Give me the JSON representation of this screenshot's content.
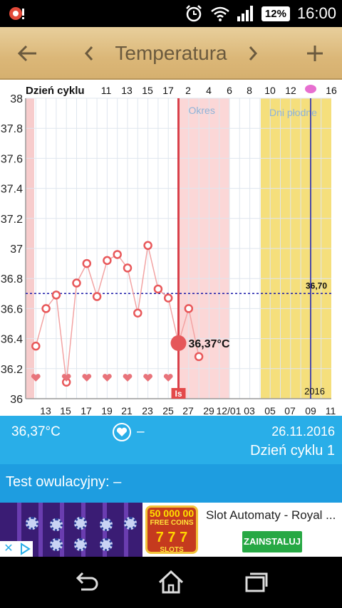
{
  "status_bar": {
    "battery": "12%",
    "time": "16:00",
    "icons": [
      "app-notification-icon",
      "alarm-clock-icon",
      "wifi-icon",
      "signal-icon",
      "battery-icon"
    ]
  },
  "toolbar": {
    "title": "Temperatura",
    "back_icon": "arrow-left-icon",
    "prev_icon": "chevron-left-icon",
    "next_icon": "chevron-right-icon",
    "add_icon": "plus-icon"
  },
  "chart_data": {
    "type": "line",
    "top_axis_title": "Dzień cyklu",
    "top_tick_labels": [
      "11",
      "13",
      "15",
      "17",
      "2",
      "4",
      "6",
      "8",
      "10",
      "12",
      "16"
    ],
    "bottom_tick_labels": [
      "13",
      "15",
      "17",
      "19",
      "21",
      "23",
      "25",
      "27",
      "29",
      "12/01",
      "03",
      "05",
      "07",
      "09",
      "11"
    ],
    "y_tick_labels": [
      "38",
      "37.8",
      "37.6",
      "37.4",
      "37.2",
      "37",
      "36.8",
      "36.6",
      "36.4",
      "36.2",
      "36"
    ],
    "ylim": [
      36,
      38
    ],
    "x": [
      "12",
      "13",
      "14",
      "15",
      "16",
      "17",
      "18",
      "19",
      "20",
      "21",
      "22",
      "23",
      "24",
      "25",
      "26",
      "27",
      "28"
    ],
    "values": [
      36.35,
      36.6,
      36.69,
      36.11,
      36.77,
      36.9,
      36.68,
      36.92,
      36.96,
      36.87,
      36.57,
      37.02,
      36.73,
      36.67,
      36.37,
      36.6,
      36.28
    ],
    "heart_days": [
      "12",
      "15",
      "17",
      "19",
      "21",
      "23",
      "25"
    ],
    "reference_line": {
      "value": 36.7,
      "label": "36,70"
    },
    "selected_point": {
      "x": "26",
      "value": 36.37,
      "label": "36,37°C"
    },
    "bands": [
      {
        "label": "",
        "color": "#f7cccc"
      },
      {
        "label": "Okres",
        "color": "#fbd7d7"
      },
      {
        "label": "Dni płodne",
        "color": "#f5df7c"
      }
    ],
    "period_marker_label": "Is",
    "year_label": "2016",
    "grid": true,
    "colors": {
      "line": "#f2a3a3",
      "marker": "#e8585a",
      "today_line": "#d9404a",
      "ref_line": "#1a1aa8",
      "ovulation_line": "#1a1aa8"
    }
  },
  "info": {
    "temperature": "36,37°C",
    "heart_text": "–",
    "date": "26.11.2016",
    "cycle_day": "Dzień cyklu 1"
  },
  "ovulation_test": {
    "label": "Test owulacyjny: –"
  },
  "ad": {
    "logo_big": "50 000 00",
    "logo_small": "FREE COINS",
    "logo_slots": "SLOTS",
    "title": "Slot Automaty - Royal ...",
    "install_label": "ZAINSTALUJ"
  },
  "nav": {
    "back_icon": "back-icon",
    "home_icon": "home-icon",
    "recents_icon": "recents-icon"
  }
}
